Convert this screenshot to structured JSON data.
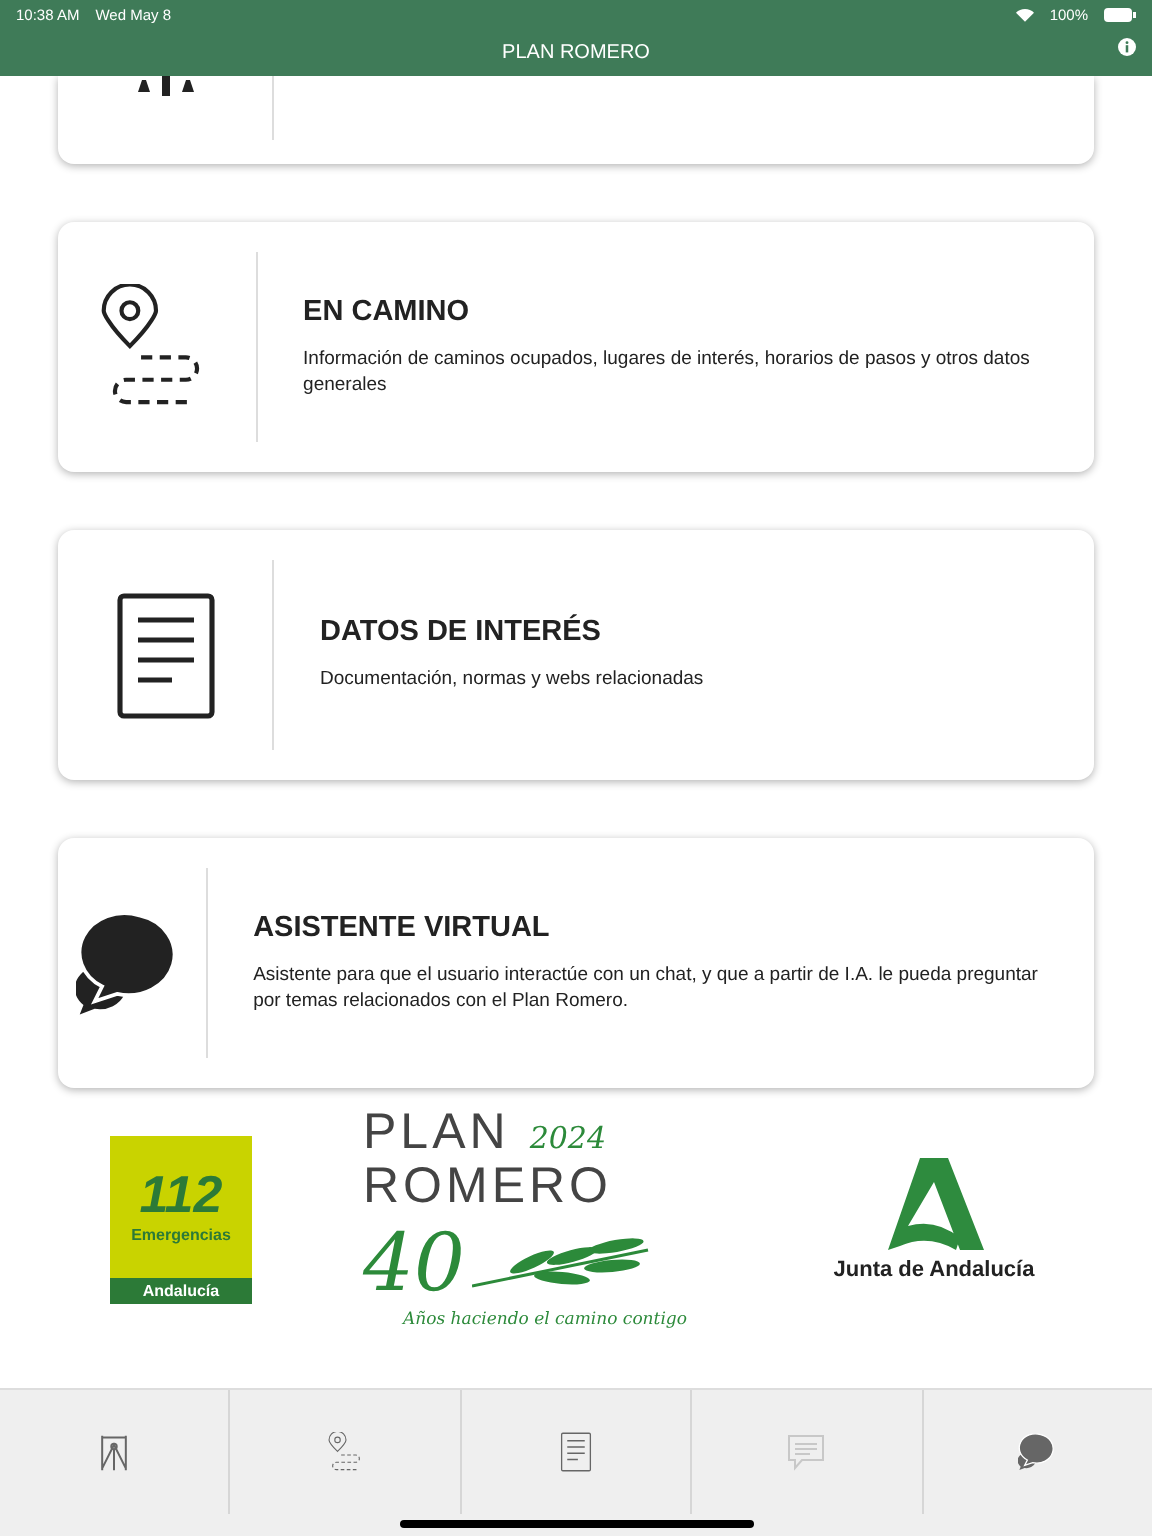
{
  "status_bar": {
    "time": "10:38 AM",
    "date": "Wed May 8",
    "battery": "100%"
  },
  "nav_bar": {
    "title": "PLAN ROMERO"
  },
  "cards": [
    {
      "kind": "partial"
    },
    {
      "kind": "route",
      "title": "EN CAMINO",
      "description": "Información de caminos ocupados, lugares de interés, horarios de pasos y otros datos generales"
    },
    {
      "kind": "document",
      "title": "DATOS DE INTERÉS",
      "description": "Documentación, normas y webs relacionadas"
    },
    {
      "kind": "chat",
      "title": "ASISTENTE VIRTUAL",
      "description": "Asistente para que el usuario interactúe con un chat, y que a partir de I.A. le pueda preguntar por temas relacionados con el Plan Romero."
    }
  ],
  "logos": {
    "emergency": {
      "number": "112",
      "label": "Emergencias",
      "region": "Andalucía"
    },
    "plan": {
      "line_1": "PLAN",
      "year": "2024",
      "line_2": "ROMERO",
      "anniversary": "40",
      "motto": "Años haciendo el camino contigo"
    },
    "government": {
      "name": "Junta de Andalucía"
    }
  },
  "tabs": [
    {
      "kind": "map",
      "disabled": false
    },
    {
      "kind": "route",
      "disabled": false
    },
    {
      "kind": "document",
      "disabled": false
    },
    {
      "kind": "message",
      "disabled": true
    },
    {
      "kind": "chat",
      "disabled": false
    }
  ]
}
